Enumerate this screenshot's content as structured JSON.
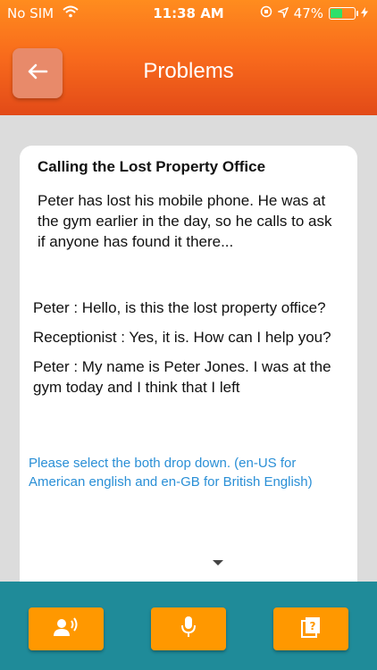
{
  "status_bar": {
    "carrier": "No SIM",
    "time": "11:38 AM",
    "battery": "47%",
    "battery_level": 0.47
  },
  "header": {
    "title": "Problems",
    "back_icon": "arrow-left-icon"
  },
  "card": {
    "title": "Calling the Lost Property Office",
    "intro": "Peter has lost his mobile phone. He was at the gym earlier in the day, so he calls to ask if anyone has found it there...",
    "dialog": [
      "Peter : Hello, is this the lost property office?",
      "Receptionist : Yes, it is. How can I help you?",
      "Peter : My name is Peter Jones. I was at the gym today and I think that I left"
    ],
    "notice": "Please select the both drop down. (en-US for American english and en-GB for British English)"
  },
  "bottom_bar": {
    "buttons": [
      {
        "icon": "speaker-person-icon"
      },
      {
        "icon": "microphone-icon"
      },
      {
        "icon": "question-cards-icon"
      }
    ]
  },
  "colors": {
    "header_orange": "#f86a1c",
    "bottom_teal": "#1f8b99",
    "button_orange": "#ff9800",
    "notice_blue": "#2a8fd6"
  }
}
